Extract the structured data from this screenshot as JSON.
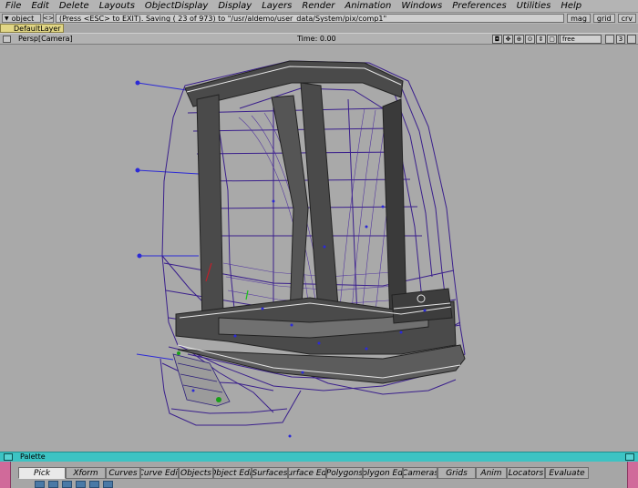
{
  "menubar": {
    "items": [
      "File",
      "Edit",
      "Delete",
      "Layouts",
      "ObjectDisplay",
      "Display",
      "Layers",
      "Render",
      "Animation",
      "Windows",
      "Preferences",
      "Utilities",
      "Help"
    ]
  },
  "prompt": {
    "mode": "object",
    "nav_glyph": "<>",
    "message": "(Press <ESC> to EXIT).  Saving ( 23 of 973) to \"/usr/aldemo/user_data/System/pix/comp1\"",
    "buttons": [
      "mag",
      "grid",
      "crv"
    ]
  },
  "layer": {
    "name": "DefaultLayer"
  },
  "viewport": {
    "title": "Persp[Camera]",
    "time": "Time: 0.00",
    "view_mode": "free",
    "number": "3",
    "tool_icons": [
      "camera-icon",
      "pan-icon",
      "zoom-icon",
      "magnify-icon",
      "dolly-icon",
      "frame-icon",
      "grid-icon"
    ]
  },
  "palette": {
    "title": "Palette",
    "tabs": [
      "Pick",
      "Xform",
      "Curves",
      "Curve Edit",
      "Objects",
      "Object Edit",
      "Surfaces",
      "Surface Edit",
      "Polygons",
      "Polygon Edit",
      "Cameras",
      "Grids",
      "Anim",
      "Locators",
      "Evaluate"
    ],
    "active_tab": "Pick"
  },
  "colors": {
    "ui_gray": "#b4b4b4",
    "viewport_bg": "#a9a9a9",
    "palette_cyan": "#3cc3c3",
    "layer_yellow": "#e2d786",
    "wire_purple": "#3b1f8a",
    "wire_blue": "#2c2ad6",
    "shaded_gray": "#4a4a4a"
  }
}
